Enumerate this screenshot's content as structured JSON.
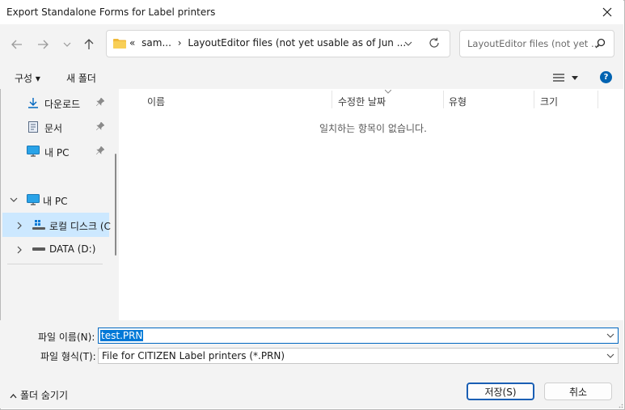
{
  "window": {
    "title": "Export Standalone Forms for Label printers"
  },
  "nav": {
    "crumbs": [
      "«",
      "sam...",
      "›",
      "LayoutEditor files (not yet usable as of Jun ..."
    ],
    "search_placeholder": "LayoutEditor files (not yet ..."
  },
  "toolbar": {
    "organize": "구성 ▾",
    "new_folder": "새 폴더"
  },
  "sidebar": {
    "quick": [
      {
        "label": "다운로드",
        "icon": "download-icon"
      },
      {
        "label": "문서",
        "icon": "document-icon"
      },
      {
        "label": "내 PC",
        "icon": "monitor-icon"
      }
    ],
    "tree": [
      {
        "label": "내 PC",
        "icon": "monitor-icon"
      },
      {
        "label": "로컬 디스크 (C",
        "icon": "drive-icon"
      },
      {
        "label": "DATA (D:)",
        "icon": "drive-icon"
      }
    ]
  },
  "list": {
    "columns": [
      "이름",
      "수정한 날짜",
      "유형",
      "크기"
    ],
    "empty_text": "일치하는 항목이 없습니다."
  },
  "form": {
    "filename_label": "파일 이름(N):",
    "filename_value": "test.PRN",
    "filetype_label": "파일 형식(T):",
    "filetype_value": "File for CITIZEN Label printers (*.PRN)"
  },
  "buttons": {
    "save": "저장(S)",
    "cancel": "취소",
    "hide_folders": "폴더 숨기기"
  },
  "colors": {
    "accent": "#0067c0",
    "selection": "#cce8ff",
    "panel": "#f3f3f3"
  }
}
